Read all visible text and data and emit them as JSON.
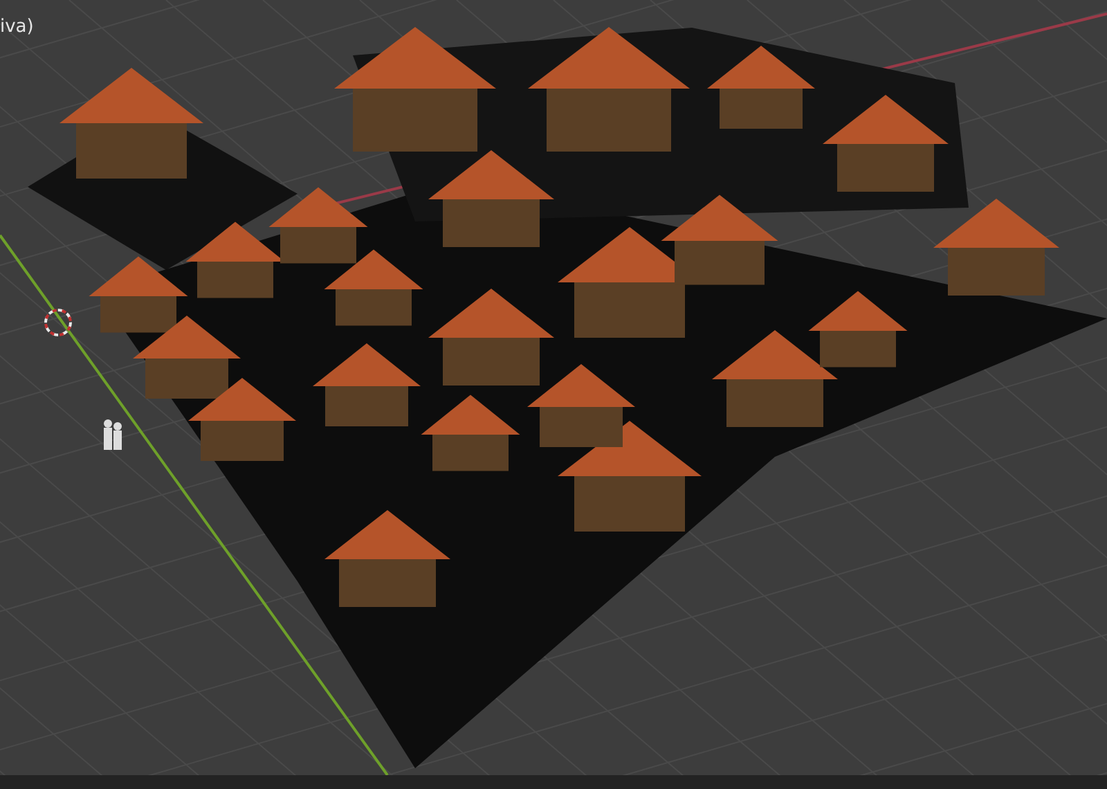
{
  "viewport": {
    "label": "iva)"
  }
}
